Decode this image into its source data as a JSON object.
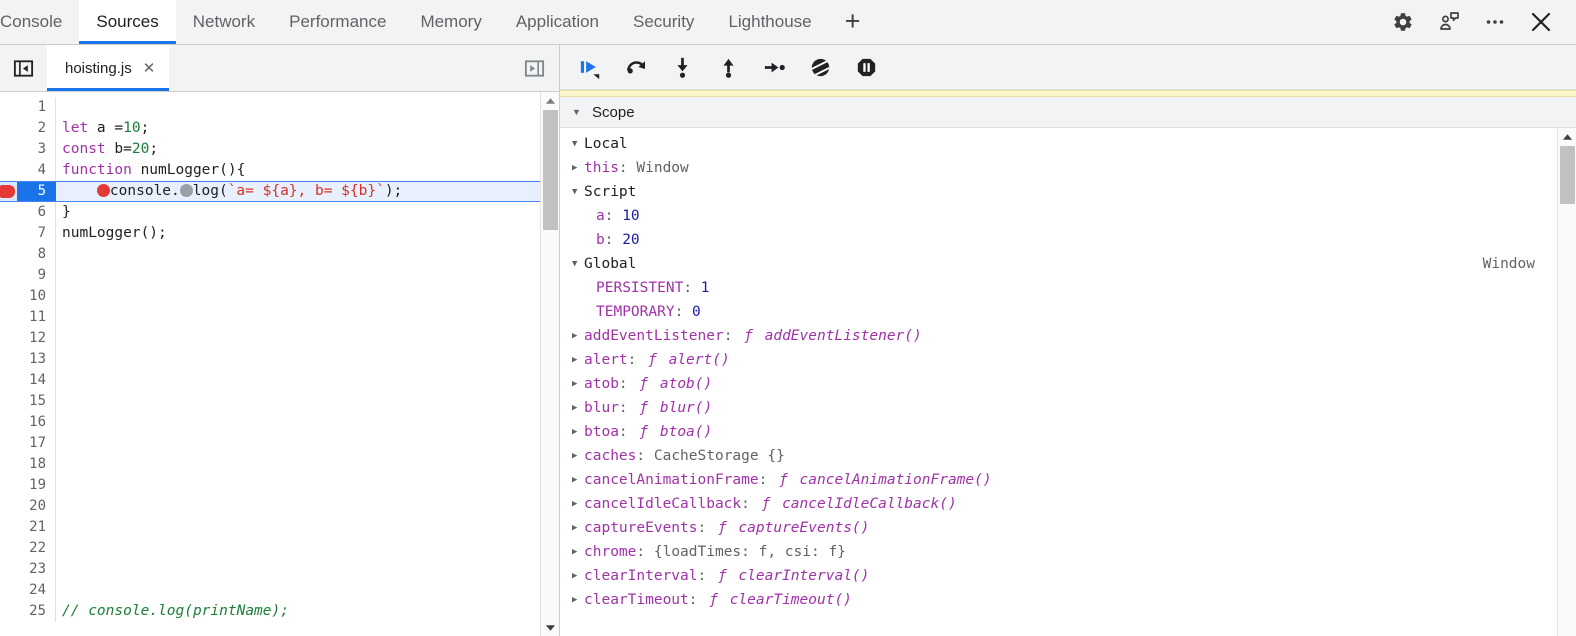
{
  "topbar": {
    "tabs": [
      {
        "label": "Console",
        "active": false
      },
      {
        "label": "Sources",
        "active": true
      },
      {
        "label": "Network",
        "active": false
      },
      {
        "label": "Performance",
        "active": false
      },
      {
        "label": "Memory",
        "active": false
      },
      {
        "label": "Application",
        "active": false
      },
      {
        "label": "Security",
        "active": false
      },
      {
        "label": "Lighthouse",
        "active": false
      }
    ],
    "add_tab_label": "+",
    "icons": [
      "gear-icon",
      "feedback-icon",
      "more-options-icon",
      "close-icon"
    ]
  },
  "sources": {
    "navigator_toggle": "show-navigator-icon",
    "debugger_toggle": "show-debugger-icon",
    "file_tab": {
      "name": "hoisting.js",
      "close": "✕"
    }
  },
  "code": {
    "lines": [
      {
        "n": "1",
        "text": "",
        "type": "empty"
      },
      {
        "n": "2",
        "text": "let a =10;",
        "type": "code"
      },
      {
        "n": "3",
        "text": "const b=20;",
        "type": "code"
      },
      {
        "n": "4",
        "text": "function numLogger(){",
        "type": "code"
      },
      {
        "n": "5",
        "text": "    console.log(`a= ${a}, b= ${b}`);",
        "type": "paused"
      },
      {
        "n": "6",
        "text": "}",
        "type": "code"
      },
      {
        "n": "7",
        "text": "numLogger();",
        "type": "code"
      },
      {
        "n": "8",
        "text": "",
        "type": "empty"
      },
      {
        "n": "9",
        "text": "",
        "type": "empty"
      },
      {
        "n": "10",
        "text": "",
        "type": "empty"
      },
      {
        "n": "11",
        "text": "",
        "type": "empty"
      },
      {
        "n": "12",
        "text": "",
        "type": "empty"
      },
      {
        "n": "13",
        "text": "",
        "type": "empty"
      },
      {
        "n": "14",
        "text": "",
        "type": "empty"
      },
      {
        "n": "15",
        "text": "",
        "type": "empty"
      },
      {
        "n": "16",
        "text": "",
        "type": "empty"
      },
      {
        "n": "17",
        "text": "",
        "type": "empty"
      },
      {
        "n": "18",
        "text": "",
        "type": "empty"
      },
      {
        "n": "19",
        "text": "",
        "type": "empty"
      },
      {
        "n": "20",
        "text": "",
        "type": "empty"
      },
      {
        "n": "21",
        "text": "",
        "type": "empty"
      },
      {
        "n": "22",
        "text": "",
        "type": "empty"
      },
      {
        "n": "23",
        "text": "",
        "type": "empty"
      },
      {
        "n": "24",
        "text": "",
        "type": "empty"
      },
      {
        "n": "25",
        "text": "// console.log(printName);",
        "type": "comment"
      }
    ],
    "breakpoint_line": "5"
  },
  "debugger": {
    "buttons": [
      {
        "name": "resume-script-execution",
        "label": "Resume"
      },
      {
        "name": "step-over-next-function-call",
        "label": "Step over"
      },
      {
        "name": "step-into-next-function-call",
        "label": "Step into"
      },
      {
        "name": "step-out-of-current-function",
        "label": "Step out"
      },
      {
        "name": "step",
        "label": "Step"
      },
      {
        "name": "deactivate-breakpoints",
        "label": "Deactivate breakpoints"
      },
      {
        "name": "pause-on-exceptions",
        "label": "Pause on exceptions"
      }
    ]
  },
  "scope": {
    "header": "Scope",
    "rows": [
      {
        "tri": "down",
        "indent": 0,
        "name": "Local",
        "sep": "",
        "value": "",
        "kind": "group"
      },
      {
        "tri": "right",
        "indent": 1,
        "name": "this",
        "sep": ": ",
        "value": "Window",
        "kind": "obj"
      },
      {
        "tri": "down",
        "indent": 0,
        "name": "Script",
        "sep": "",
        "value": "",
        "kind": "group"
      },
      {
        "tri": "none",
        "indent": 2,
        "name": "a",
        "sep": ": ",
        "value": "10",
        "kind": "num"
      },
      {
        "tri": "none",
        "indent": 2,
        "name": "b",
        "sep": ": ",
        "value": "20",
        "kind": "num"
      },
      {
        "tri": "down",
        "indent": 0,
        "name": "Global",
        "sep": "",
        "value": "",
        "kind": "group",
        "right_label": "Window"
      },
      {
        "tri": "none",
        "indent": 2,
        "name": "PERSISTENT",
        "sep": ": ",
        "value": "1",
        "kind": "num"
      },
      {
        "tri": "none",
        "indent": 2,
        "name": "TEMPORARY",
        "sep": ": ",
        "value": "0",
        "kind": "num"
      },
      {
        "tri": "right",
        "indent": 1,
        "name": "addEventListener",
        "sep": ": ",
        "value": "addEventListener()",
        "kind": "fn"
      },
      {
        "tri": "right",
        "indent": 1,
        "name": "alert",
        "sep": ": ",
        "value": "alert()",
        "kind": "fn"
      },
      {
        "tri": "right",
        "indent": 1,
        "name": "atob",
        "sep": ": ",
        "value": "atob()",
        "kind": "fn"
      },
      {
        "tri": "right",
        "indent": 1,
        "name": "blur",
        "sep": ": ",
        "value": "blur()",
        "kind": "fn"
      },
      {
        "tri": "right",
        "indent": 1,
        "name": "btoa",
        "sep": ": ",
        "value": "btoa()",
        "kind": "fn"
      },
      {
        "tri": "right",
        "indent": 1,
        "name": "caches",
        "sep": ": ",
        "value": "CacheStorage {}",
        "kind": "obj"
      },
      {
        "tri": "right",
        "indent": 1,
        "name": "cancelAnimationFrame",
        "sep": ": ",
        "value": "cancelAnimationFrame()",
        "kind": "fn"
      },
      {
        "tri": "right",
        "indent": 1,
        "name": "cancelIdleCallback",
        "sep": ": ",
        "value": "cancelIdleCallback()",
        "kind": "fn"
      },
      {
        "tri": "right",
        "indent": 1,
        "name": "captureEvents",
        "sep": ": ",
        "value": "captureEvents()",
        "kind": "fn"
      },
      {
        "tri": "right",
        "indent": 1,
        "name": "chrome",
        "sep": ": ",
        "value": "{loadTimes: f, csi: f}",
        "kind": "obj"
      },
      {
        "tri": "right",
        "indent": 1,
        "name": "clearInterval",
        "sep": ": ",
        "value": "clearInterval()",
        "kind": "fn"
      },
      {
        "tri": "right",
        "indent": 1,
        "name": "clearTimeout",
        "sep": ": ",
        "value": "clearTimeout()",
        "kind": "fn"
      }
    ]
  },
  "colors": {
    "accent": "#1a73e8",
    "breakpoint": "#e53935",
    "keyword": "#a32fa8",
    "number": "#1a7f37",
    "string": "#d93025",
    "comment": "#1a7f37",
    "property": "#a032a8",
    "paused_bar": "#fcf7c8"
  }
}
